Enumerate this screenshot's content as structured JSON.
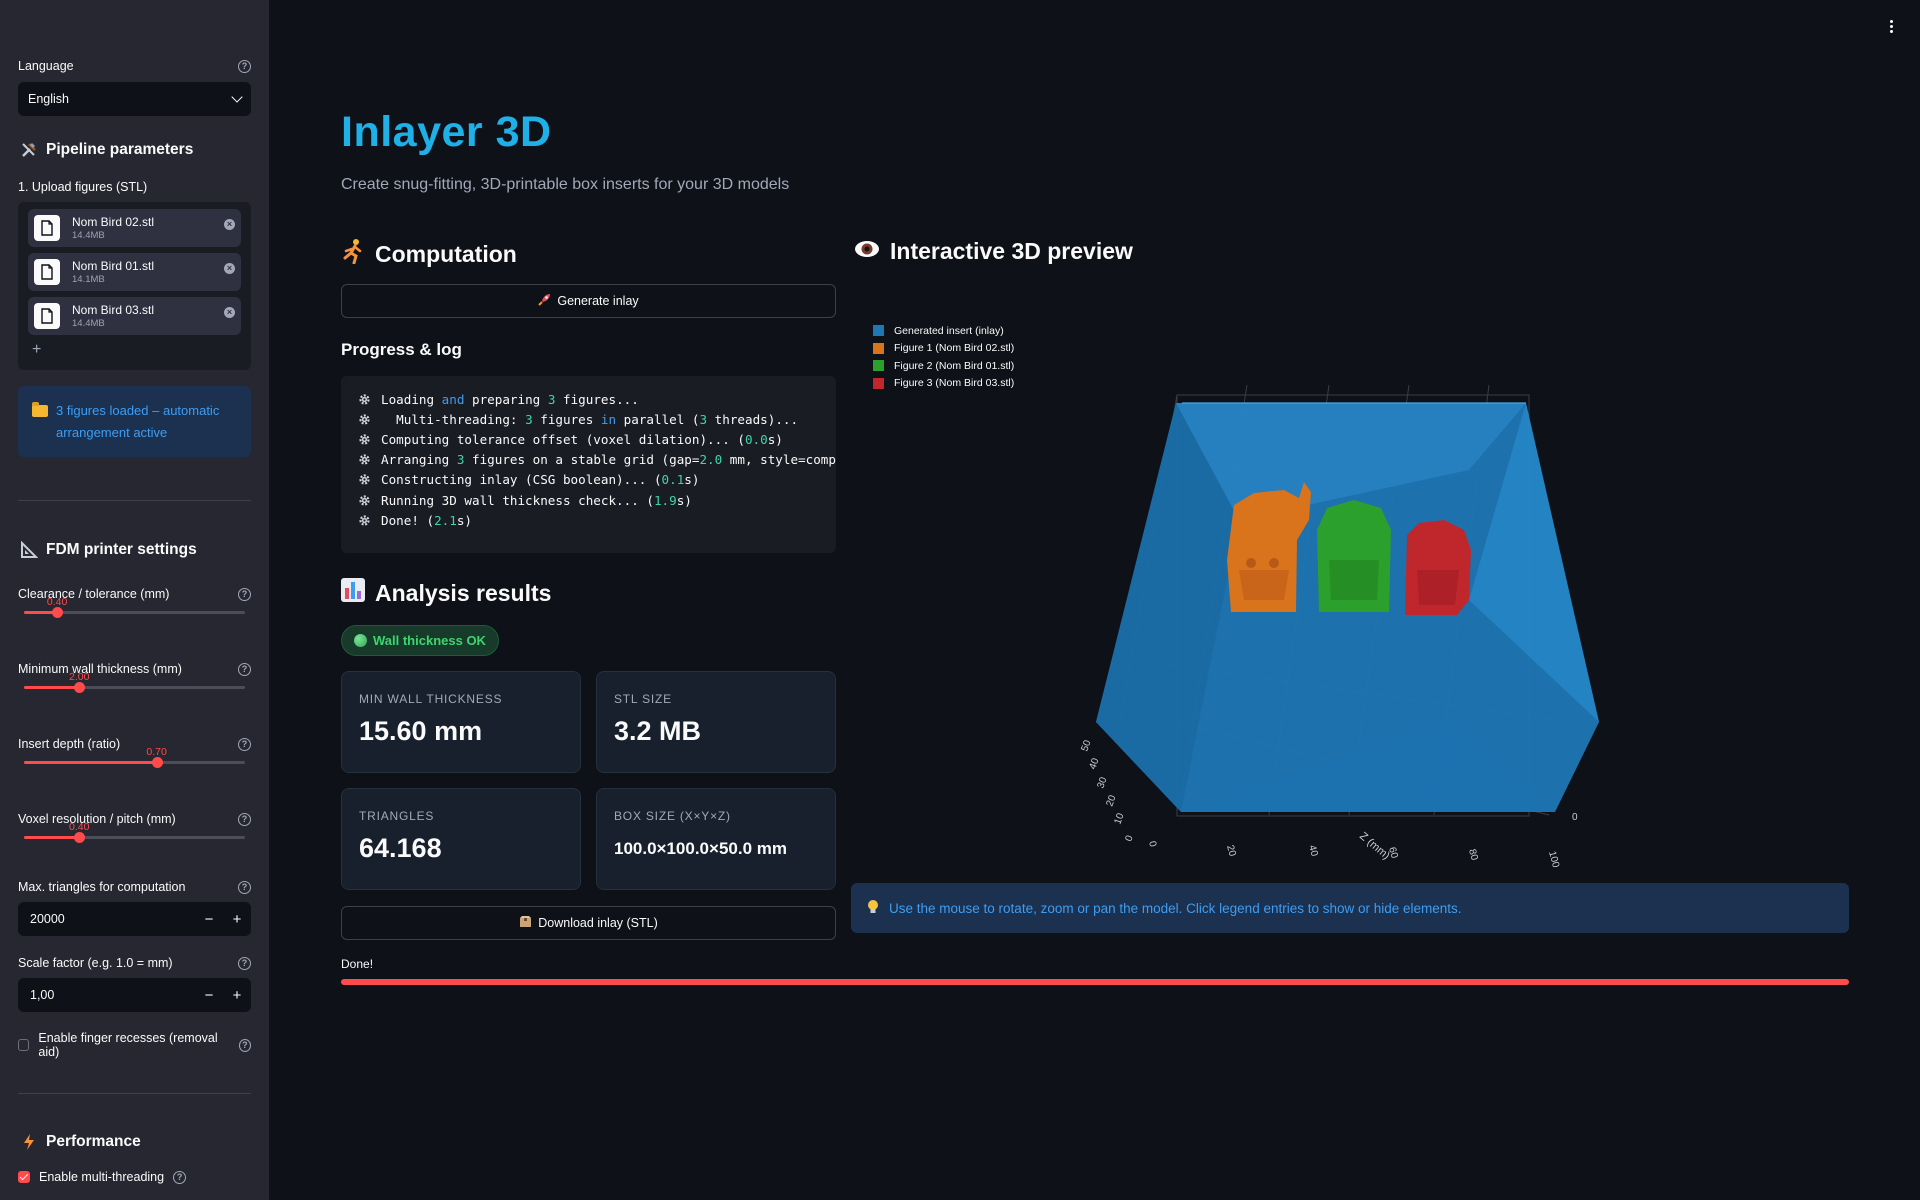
{
  "sidebar": {
    "language_label": "Language",
    "language_value": "English",
    "pipeline_title": "Pipeline parameters",
    "upload_label": "1. Upload figures (STL)",
    "files": [
      {
        "name": "Nom Bird 02.stl",
        "size": "14.4MB"
      },
      {
        "name": "Nom Bird 01.stl",
        "size": "14.1MB"
      },
      {
        "name": "Nom Bird 03.stl",
        "size": "14.4MB"
      }
    ],
    "add_label": "+",
    "info_text": "3 figures loaded – automatic arrangement active",
    "printer_title": "FDM printer settings",
    "sliders": [
      {
        "label": "Clearance / tolerance (mm)",
        "value": "0.40",
        "fraction": 0.15
      },
      {
        "label": "Minimum wall thickness (mm)",
        "value": "2.00",
        "fraction": 0.25
      },
      {
        "label": "Insert depth (ratio)",
        "value": "0.70",
        "fraction": 0.6
      },
      {
        "label": "Voxel resolution / pitch (mm)",
        "value": "0.40",
        "fraction": 0.25
      }
    ],
    "max_triangles_label": "Max. triangles for computation",
    "max_triangles_value": "20000",
    "scale_label": "Scale factor (e.g. 1.0 = mm)",
    "scale_value": "1,00",
    "finger_label": "Enable finger recesses (removal aid)",
    "finger_checked": false,
    "performance_title": "Performance",
    "multithread_label": "Enable multi-threading",
    "multithread_checked": true,
    "stepper_minus": "−",
    "stepper_plus": "+"
  },
  "main": {
    "title": "Inlayer 3D",
    "subtitle": "Create snug-fitting, 3D-printable box inserts for your 3D models",
    "computation_title": "Computation",
    "generate_label": "Generate inlay",
    "progress_title": "Progress & log",
    "log_lines": [
      [
        [
          "Loading ",
          ""
        ],
        [
          "and",
          "kw"
        ],
        [
          " preparing ",
          ""
        ],
        [
          "3",
          "nm"
        ],
        [
          " figures...",
          ""
        ]
      ],
      [
        [
          "  Multi-threading: ",
          ""
        ],
        [
          "3",
          "nm"
        ],
        [
          " figures ",
          ""
        ],
        [
          "in",
          "kw"
        ],
        [
          " parallel (",
          ""
        ],
        [
          "3",
          "nm"
        ],
        [
          " threads)...",
          ""
        ]
      ],
      [
        [
          "Computing tolerance offset (voxel dilation)... (",
          ""
        ],
        [
          "0.0",
          "nm"
        ],
        [
          "s)",
          ""
        ]
      ],
      [
        [
          "Arranging ",
          ""
        ],
        [
          "3",
          "nm"
        ],
        [
          " figures on a stable grid (gap=",
          ""
        ],
        [
          "2.0",
          "nm"
        ],
        [
          " mm, style=compact)",
          ""
        ]
      ],
      [
        [
          "Constructing inlay (CSG boolean)... (",
          ""
        ],
        [
          "0.1",
          "nm"
        ],
        [
          "s)",
          ""
        ]
      ],
      [
        [
          "Running 3D wall thickness check... (",
          ""
        ],
        [
          "1.9",
          "nm"
        ],
        [
          "s)",
          ""
        ]
      ],
      [
        [
          "Done! (",
          ""
        ],
        [
          "2.1",
          "nm"
        ],
        [
          "s)",
          ""
        ]
      ]
    ],
    "analysis_title": "Analysis results",
    "badge": "Wall thickness OK",
    "cards": {
      "min_wall_label": "Min wall thickness",
      "min_wall_value": "15.60 mm",
      "stl_label": "STL size",
      "stl_value": "3.2 MB",
      "tri_label": "Triangles",
      "tri_value": "64.168",
      "box_label": "Box size (X×Y×Z)",
      "box_value": "100.0×100.0×50.0 mm"
    },
    "download_label": "Download inlay (STL)",
    "done_label": "Done!",
    "progress_fraction": 1.0,
    "preview_title": "Interactive 3D preview",
    "hint": "Use the mouse to rotate, zoom or pan the model. Click legend entries to show or hide elements."
  },
  "legend": [
    {
      "name": "Generated insert (inlay)",
      "color": "#1f77b4"
    },
    {
      "name": "Figure 1 (Nom Bird 02.stl)",
      "color": "#d9731c"
    },
    {
      "name": "Figure 2 (Nom Bird 01.stl)",
      "color": "#2ca02c"
    },
    {
      "name": "Figure 3 (Nom Bird 03.stl)",
      "color": "#c0272d"
    }
  ],
  "axes": {
    "x_ticks": [
      "0",
      "20",
      "40",
      "60",
      "80",
      "100"
    ],
    "z_ticks": [
      "0",
      "10",
      "20",
      "30",
      "40",
      "50"
    ],
    "z_title": "Z (mm)",
    "y_tick": "0"
  },
  "colors": {
    "accent": "#ff4b4b",
    "title": "#1fb0e8",
    "info": "#3d9df3",
    "ok": "#3dd56d"
  }
}
